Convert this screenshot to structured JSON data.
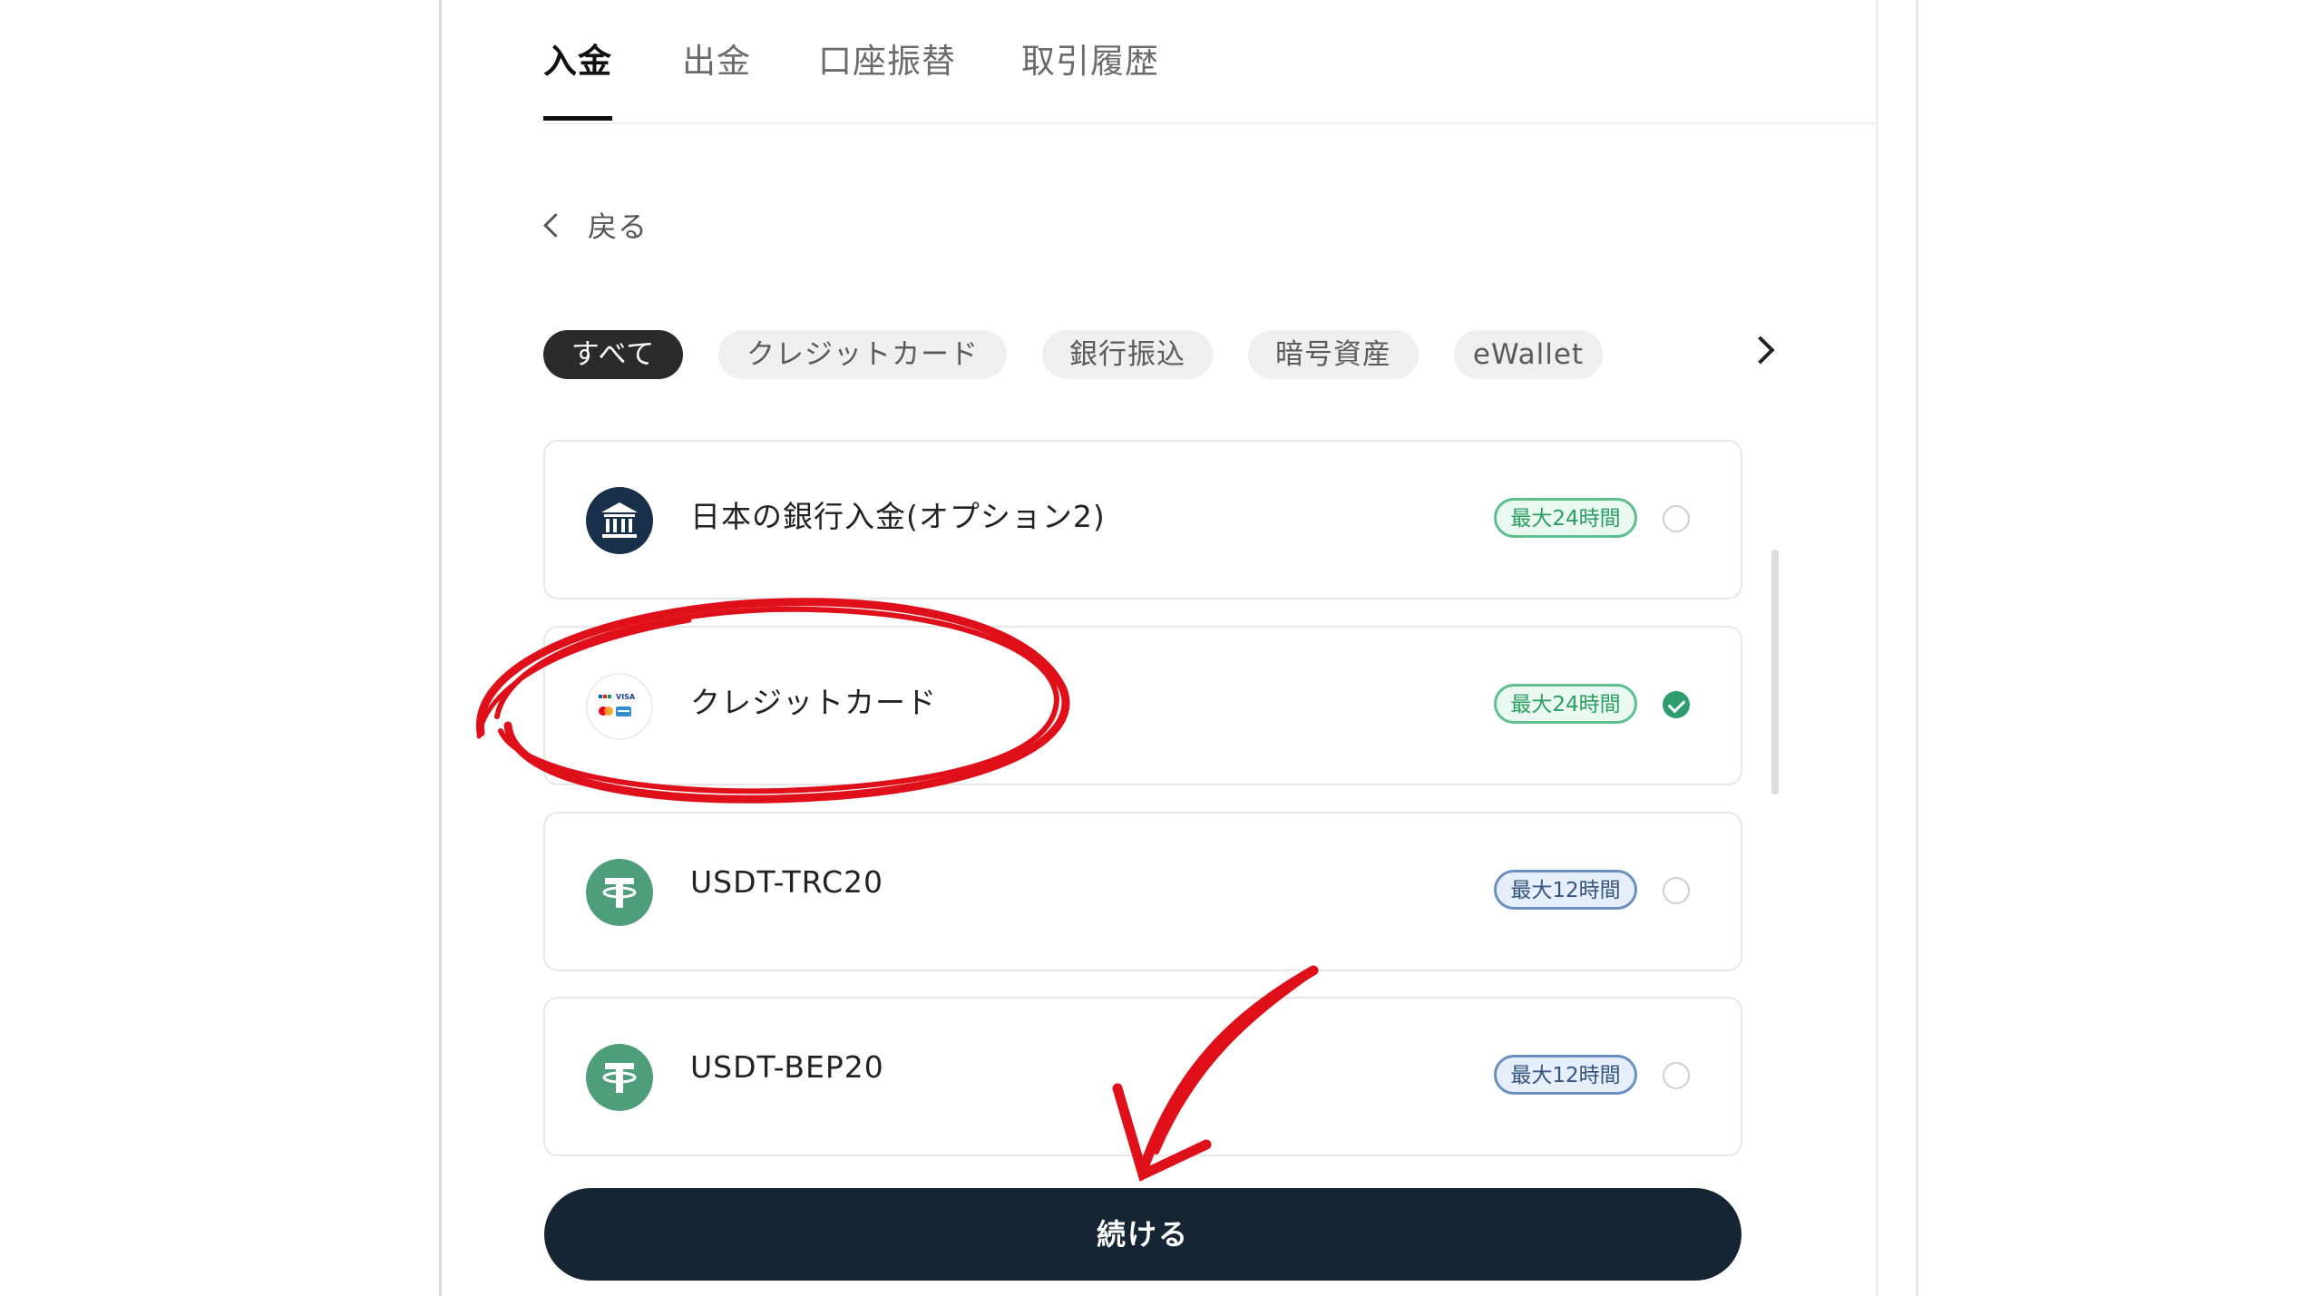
{
  "tabs": [
    "入金",
    "出金",
    "口座振替",
    "取引履歴"
  ],
  "back_label": "戻る",
  "filters": [
    "すべて",
    "クレジットカード",
    "銀行振込",
    "暗号資産",
    "eWallet"
  ],
  "methods": [
    {
      "title": "日本の銀行入金(オプション2)",
      "badge": "最大24時間",
      "badge_color": "green",
      "selected": false,
      "icon": "bank-icon"
    },
    {
      "title": "クレジットカード",
      "badge": "最大24時間",
      "badge_color": "green",
      "selected": true,
      "icon": "credit-card-icon"
    },
    {
      "title": "USDT-TRC20",
      "badge": "最大12時間",
      "badge_color": "blue",
      "selected": false,
      "icon": "tether-icon"
    },
    {
      "title": "USDT-BEP20",
      "badge": "最大12時間",
      "badge_color": "blue",
      "selected": false,
      "icon": "tether-icon"
    }
  ],
  "continue_label": "続ける",
  "colors": {
    "accent_dark": "#162533",
    "green_badge": "#2c9e62",
    "blue_badge": "#33557f",
    "annotation_red": "#e0101a"
  }
}
